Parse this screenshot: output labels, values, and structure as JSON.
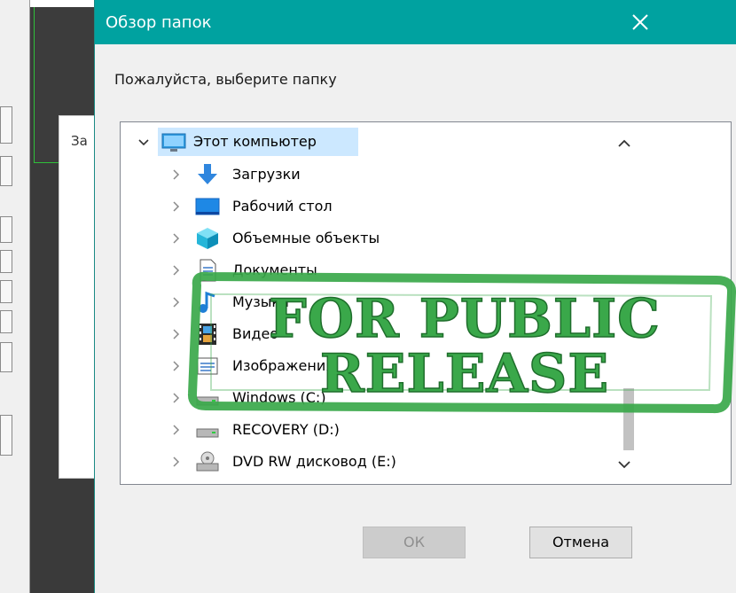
{
  "background": {
    "window_title": "За",
    "accent_green": "#2fbf3a"
  },
  "dialog": {
    "title": "Обзор папок",
    "prompt": "Пожалуйста, выберите папку",
    "titlebar_color": "#00a2a0",
    "buttons": {
      "ok": "ОК",
      "cancel": "Отмена"
    },
    "tree": {
      "root": {
        "label": "Этот компьютер",
        "icon": "computer-icon",
        "expanded": true
      },
      "items": [
        {
          "label": "Загрузки",
          "icon": "download-arrow-icon"
        },
        {
          "label": "Рабочий стол",
          "icon": "desktop-icon"
        },
        {
          "label": "Объемные объекты",
          "icon": "3d-cube-icon"
        },
        {
          "label": "Документы",
          "icon": "document-icon"
        },
        {
          "label": "Музыка",
          "icon": "music-icon"
        },
        {
          "label": "Видео",
          "icon": "video-icon"
        },
        {
          "label": "Изображения",
          "icon": "pictures-icon"
        },
        {
          "label": "Windows (C:)",
          "icon": "drive-icon"
        },
        {
          "label": "RECOVERY (D:)",
          "icon": "drive-icon"
        },
        {
          "label": "DVD RW дисковод (E:)",
          "icon": "dvd-drive-icon"
        }
      ]
    }
  },
  "stamp": {
    "line1": "FOR PUBLIC",
    "line2": "RELEASE",
    "color": "#3aa84a"
  }
}
